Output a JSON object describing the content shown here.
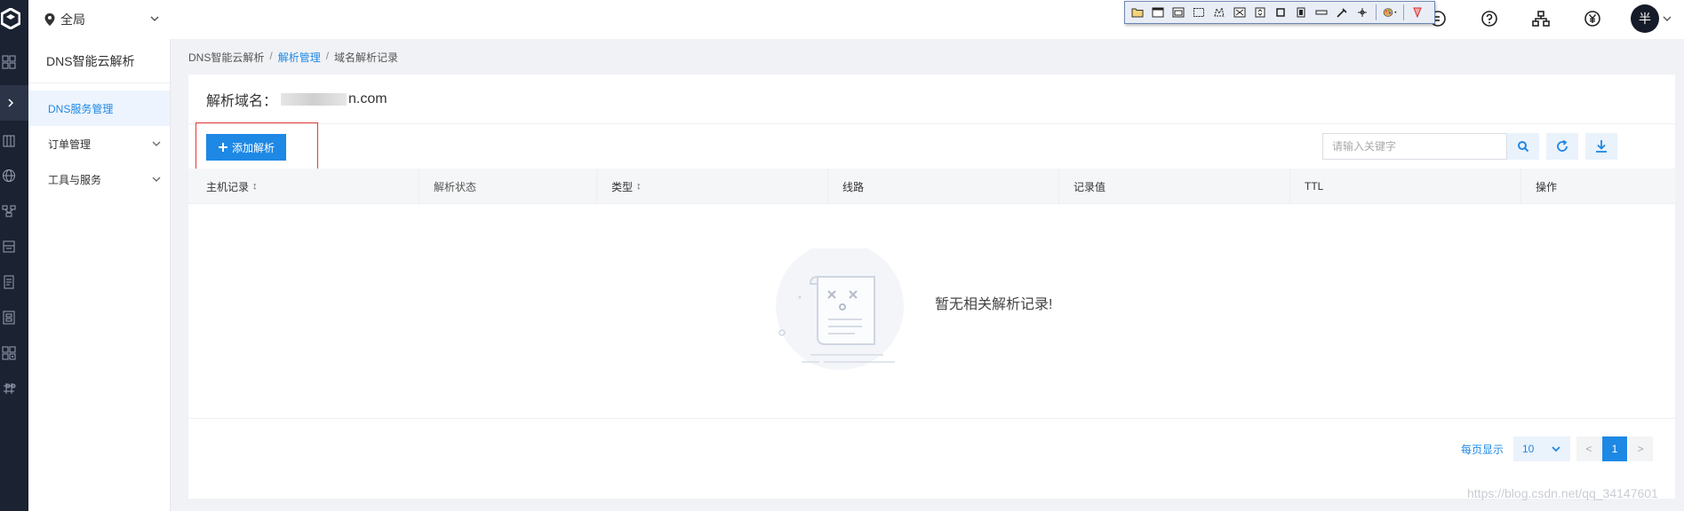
{
  "topbar": {
    "region_label": "全局",
    "avatar_text": "半"
  },
  "subnav": {
    "title": "DNS智能云解析",
    "items": [
      {
        "label": "DNS服务管理",
        "active": true,
        "expandable": false
      },
      {
        "label": "订单管理",
        "active": false,
        "expandable": true
      },
      {
        "label": "工具与服务",
        "active": false,
        "expandable": true
      }
    ]
  },
  "breadcrumb": {
    "root": "DNS智能云解析",
    "mid": "解析管理",
    "current": "域名解析记录",
    "sep": "/"
  },
  "domain": {
    "label": "解析域名：",
    "value_tail": "n.com"
  },
  "toolbar": {
    "add_label": "添加解析",
    "search_placeholder": "请输入关键字"
  },
  "table": {
    "columns": [
      {
        "label": "主机记录",
        "sortable": true
      },
      {
        "label": "解析状态",
        "sortable": false
      },
      {
        "label": "类型",
        "sortable": true
      },
      {
        "label": "线路",
        "sortable": false
      },
      {
        "label": "记录值",
        "sortable": false
      },
      {
        "label": "TTL",
        "sortable": false
      },
      {
        "label": "操作",
        "sortable": false
      }
    ],
    "empty_text": "暂无相关解析记录!"
  },
  "pagination": {
    "per_page_label": "每页显示",
    "per_page_value": "10",
    "prev": "<",
    "next": ">",
    "current_page": "1"
  },
  "watermark": "https://blog.csdn.net/qq_34147601",
  "colors": {
    "accent": "#1e88e5",
    "rail": "#1b2231",
    "highlight": "#e53935"
  }
}
